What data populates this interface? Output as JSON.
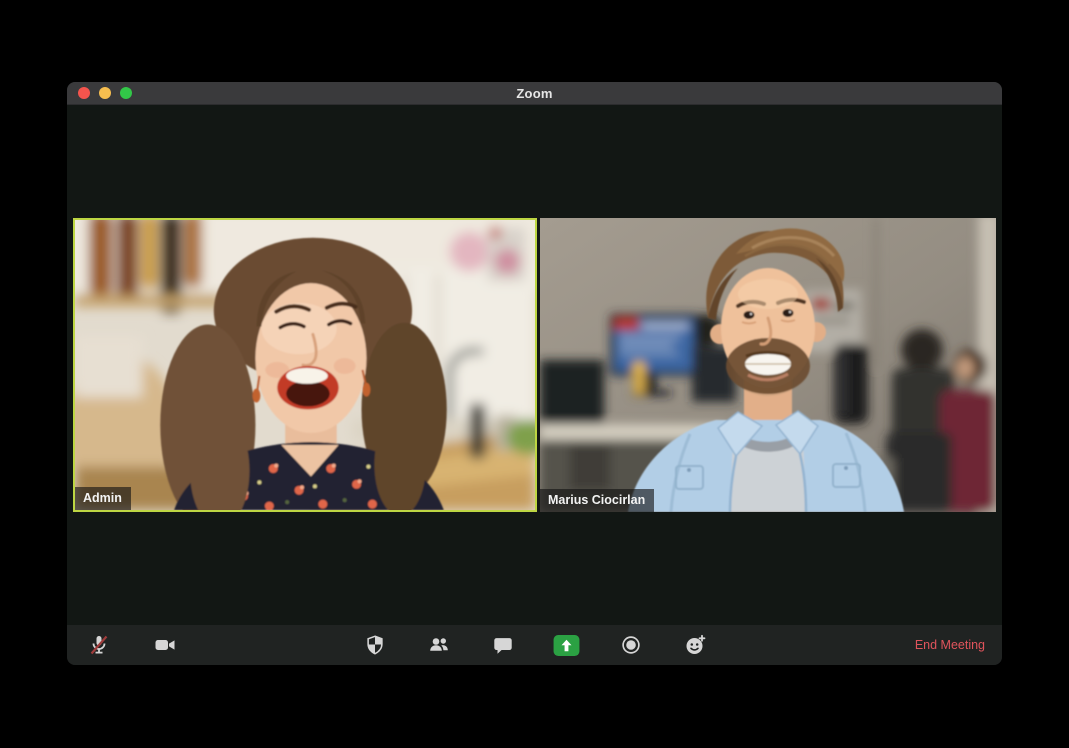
{
  "window": {
    "title": "Zoom",
    "controls": {
      "close": "close",
      "minimize": "minimize",
      "fullscreen": "fullscreen"
    }
  },
  "participants": [
    {
      "name": "Admin",
      "active_speaker": true,
      "tile_position": "left"
    },
    {
      "name": "Marius Ciocirlan",
      "active_speaker": false,
      "tile_position": "right"
    }
  ],
  "toolbar": {
    "buttons": [
      {
        "id": "mute",
        "icon": "microphone-muted-icon",
        "state": "muted"
      },
      {
        "id": "video",
        "icon": "video-camera-icon",
        "state": "on"
      },
      {
        "id": "security",
        "icon": "security-shield-icon"
      },
      {
        "id": "participants",
        "icon": "participants-icon"
      },
      {
        "id": "chat",
        "icon": "chat-bubble-icon"
      },
      {
        "id": "share-screen",
        "icon": "share-screen-icon",
        "highlighted": true
      },
      {
        "id": "record",
        "icon": "record-icon"
      },
      {
        "id": "reactions",
        "icon": "reactions-icon"
      }
    ],
    "end_meeting_label": "End Meeting"
  },
  "colors": {
    "share_button_green": "#2ba143",
    "end_meeting_red": "#e0545c",
    "active_speaker_border": "#bdd643",
    "titlebar_bg": "#3a3a3c",
    "toolbar_bg": "#202322",
    "stage_bg": "#121714",
    "traffic_red": "#f4544d",
    "traffic_yellow": "#f6be4f",
    "traffic_green": "#32c748"
  }
}
